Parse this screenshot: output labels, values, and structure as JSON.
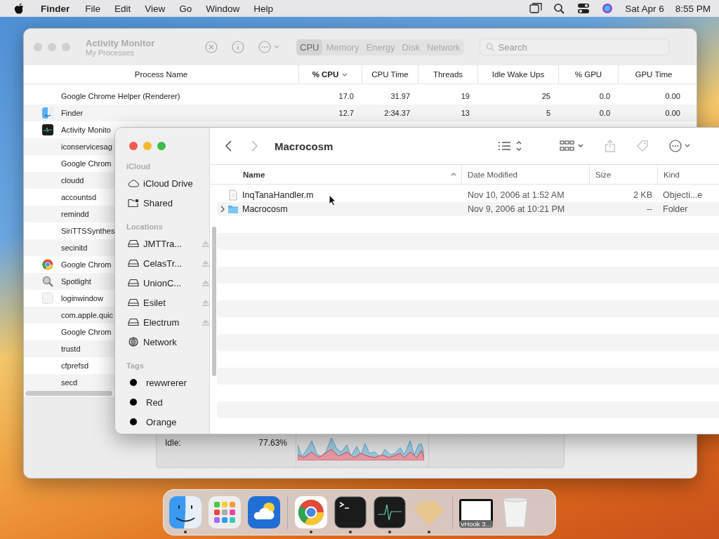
{
  "menu_bar": {
    "app_name": "Finder",
    "menus": [
      "File",
      "Edit",
      "View",
      "Go",
      "Window",
      "Help"
    ],
    "date": "Sat Apr 6",
    "time": "8:55 PM"
  },
  "activity_monitor": {
    "title": "Activity Monitor",
    "subtitle": "My Processes",
    "tabs": [
      {
        "label": "CPU",
        "selected": true
      },
      {
        "label": "Memory",
        "selected": false
      },
      {
        "label": "Energy",
        "selected": false
      },
      {
        "label": "Disk",
        "selected": false
      },
      {
        "label": "Network",
        "selected": false
      }
    ],
    "search": {
      "placeholder": "Search"
    },
    "columns": [
      {
        "label": "Process Name",
        "sorted": false
      },
      {
        "label": "% CPU",
        "sorted": true,
        "descending": true
      },
      {
        "label": "CPU Time",
        "sorted": false
      },
      {
        "label": "Threads",
        "sorted": false
      },
      {
        "label": "Idle Wake Ups",
        "sorted": false
      },
      {
        "label": "% GPU",
        "sorted": false
      },
      {
        "label": "GPU Time",
        "sorted": false
      }
    ],
    "rows": [
      {
        "name": "Google Chrome Helper (Renderer)",
        "kind": "plain",
        "values": [
          "17.0",
          "31.97",
          "19",
          "25",
          "0.0",
          "0.00"
        ]
      },
      {
        "name": "Finder",
        "kind": "finder",
        "values": [
          "12.7",
          "2:34.37",
          "13",
          "5",
          "0.0",
          "0.00"
        ]
      },
      {
        "name": "Activity Monito",
        "kind": "monitor"
      },
      {
        "name": "iconservicesag",
        "kind": "plain"
      },
      {
        "name": "Google Chrom",
        "kind": "plain"
      },
      {
        "name": "cloudd",
        "kind": "plain"
      },
      {
        "name": "accountsd",
        "kind": "plain"
      },
      {
        "name": "remindd",
        "kind": "plain"
      },
      {
        "name": "SiriTTSSynthes",
        "kind": "plain"
      },
      {
        "name": "secinitd",
        "kind": "plain"
      },
      {
        "name": "Google Chrom",
        "kind": "chrome"
      },
      {
        "name": "Spotlight",
        "kind": "search"
      },
      {
        "name": "loginwindow",
        "kind": "window"
      },
      {
        "name": "com.apple.quic",
        "kind": "plain"
      },
      {
        "name": "Google Chrom",
        "kind": "plain"
      },
      {
        "name": "trustd",
        "kind": "plain"
      },
      {
        "name": "cfprefsd",
        "kind": "plain"
      },
      {
        "name": "secd",
        "kind": "plain"
      }
    ],
    "stats": {
      "label": "Idle:",
      "value": "77.63%"
    }
  },
  "finder": {
    "title": "Macrocosm",
    "sidebar": [
      {
        "heading": "iCloud",
        "items": [
          {
            "label": "iCloud Drive",
            "kind": "cloud",
            "eject": false
          },
          {
            "label": "Shared",
            "kind": "shared",
            "eject": false
          }
        ]
      },
      {
        "heading": "Locations",
        "items": [
          {
            "label": "JMTTra...",
            "kind": "drive",
            "eject": true
          },
          {
            "label": "CelasTr...",
            "kind": "drive",
            "eject": true
          },
          {
            "label": "UnionC...",
            "kind": "drive",
            "eject": true
          },
          {
            "label": "Esilet",
            "kind": "drive",
            "eject": true
          },
          {
            "label": "Electrum",
            "kind": "drive",
            "eject": true
          },
          {
            "label": "Network",
            "kind": "globe",
            "eject": false
          }
        ]
      },
      {
        "heading": "Tags",
        "items": [
          {
            "label": "rewwrerer",
            "kind": "tag",
            "eject": false
          },
          {
            "label": "Red",
            "kind": "tag",
            "eject": false
          },
          {
            "label": "Orange",
            "kind": "tag",
            "eject": false
          }
        ]
      }
    ],
    "columns": [
      {
        "label": "Name",
        "sorted": true,
        "descending": false
      },
      {
        "label": "Date Modified",
        "sorted": false
      },
      {
        "label": "Size",
        "sorted": false
      },
      {
        "label": "Kind",
        "sorted": false
      }
    ],
    "files": [
      {
        "name": "InqTanaHandler.m",
        "kind": "document",
        "expandable": false,
        "date": "Nov 10, 2006 at 1:52 AM",
        "size": "2 KB",
        "file_kind": "Objecti...e"
      },
      {
        "name": "Macrocosm",
        "kind": "folder",
        "expandable": true,
        "date": "Nov 9, 2006 at 10:21 PM",
        "size": "--",
        "file_kind": "Folder"
      }
    ]
  },
  "dock": {
    "items": [
      {
        "kind": "finder",
        "running": true
      },
      {
        "kind": "launchpad",
        "running": false
      },
      {
        "kind": "weather",
        "running": false
      },
      {
        "kind": "separator"
      },
      {
        "kind": "chrome",
        "running": true
      },
      {
        "kind": "terminal",
        "running": true
      },
      {
        "kind": "monitor",
        "running": true
      },
      {
        "kind": "sketch",
        "running": true
      },
      {
        "kind": "separator"
      },
      {
        "kind": "window",
        "label": "vHook 3...",
        "running": false
      },
      {
        "kind": "trash",
        "running": false
      }
    ]
  }
}
